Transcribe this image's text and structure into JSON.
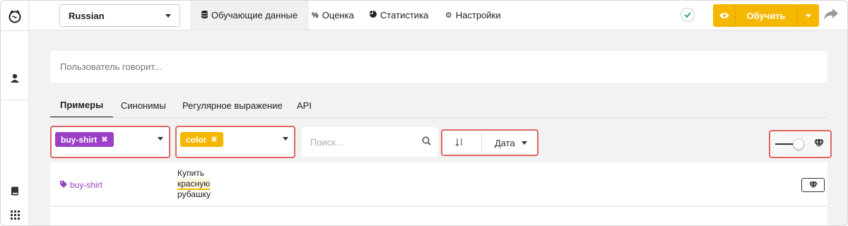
{
  "language": {
    "selected": "Russian"
  },
  "nav": {
    "tabs": [
      {
        "label": "Обучающие данные",
        "icon": "database-icon"
      },
      {
        "label": "Оценка",
        "icon": "percent-icon"
      },
      {
        "label": "Статистика",
        "icon": "pie-chart-icon"
      },
      {
        "label": "Настройки",
        "icon": "gear-icon"
      }
    ]
  },
  "actions": {
    "train_label": "Обучить"
  },
  "search_bar": {
    "placeholder": "Пользователь говорит..."
  },
  "subtabs": [
    {
      "label": "Примеры"
    },
    {
      "label": "Синонимы"
    },
    {
      "label": "Регулярное выражение"
    },
    {
      "label": "API"
    }
  ],
  "filters": {
    "intent_tag": {
      "label": "buy-shirt",
      "color": "#9b3fc6"
    },
    "entity_tag": {
      "label": "color",
      "color": "#f5b700"
    },
    "search_placeholder": "Поиск...",
    "sort_label": "Дата"
  },
  "examples": [
    {
      "intent": "buy-shirt",
      "text_before": "Купить",
      "entity_text": "красную",
      "text_after": "рубашку"
    }
  ],
  "colors": {
    "accent": "#f5b700",
    "intent": "#9b3fc6",
    "highlight": "#e06666"
  }
}
